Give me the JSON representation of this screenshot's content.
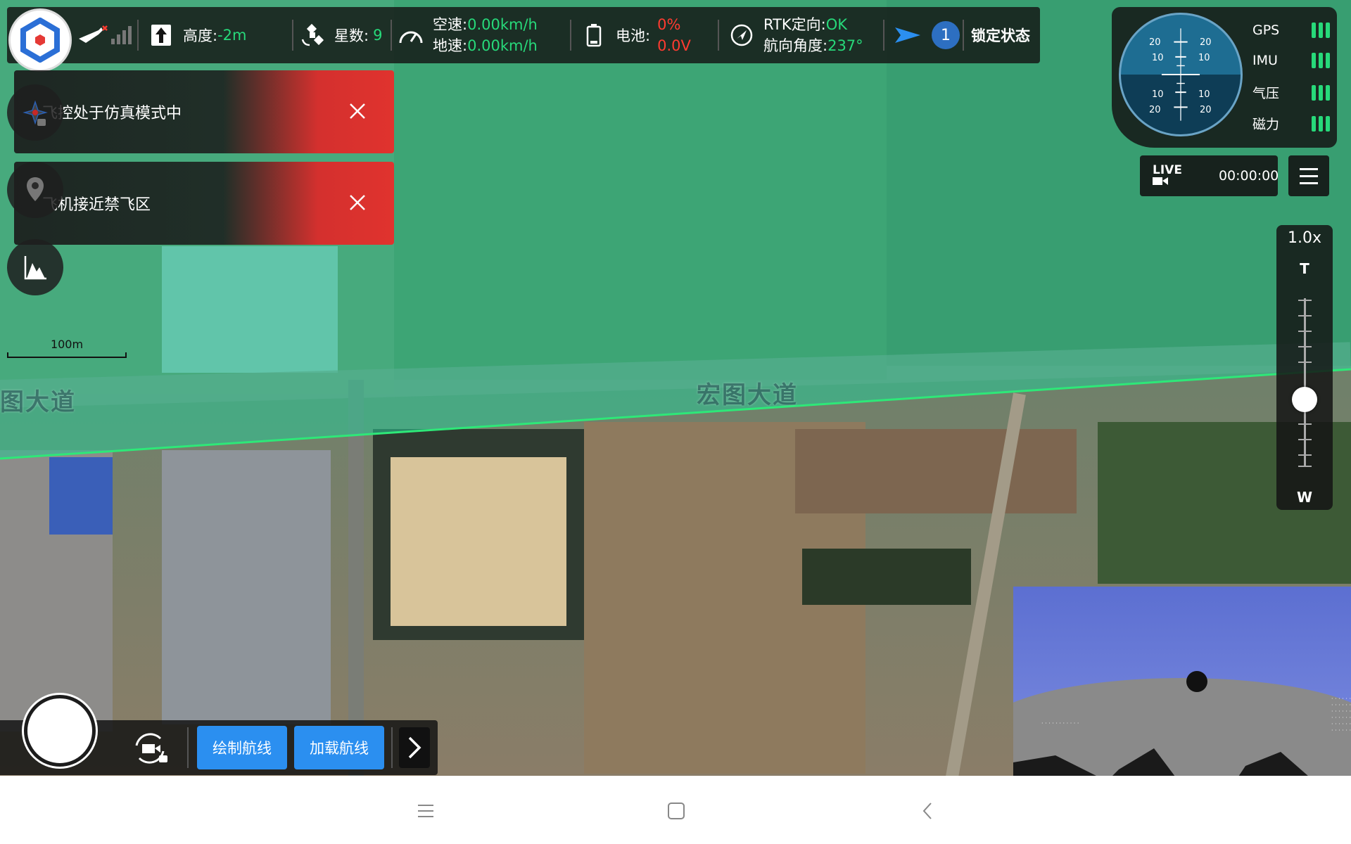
{
  "map": {
    "road_name_main": "宏图大道",
    "road_name_left": "图大道",
    "scale_label": "100m",
    "nofly_color": "#28c896"
  },
  "topbar": {
    "altitude_label": "高度:",
    "altitude_value": "-2m",
    "satellites_label": "星数:",
    "satellites_value": "9",
    "airspeed_label": "空速:",
    "airspeed_value": "0.00km/h",
    "groundspeed_label": "地速:",
    "groundspeed_value": "0.00km/h",
    "battery_label": "电池:",
    "battery_percent": "0%",
    "battery_voltage": "0.0V",
    "rtk_label": "RTK定向:",
    "rtk_value": "OK",
    "heading_label": "航向角度:",
    "heading_value": "237°",
    "aircraft_count": "1",
    "lock_state": "锁定状态"
  },
  "attitude": {
    "pitch_marks": [
      "20",
      "10",
      "10",
      "20"
    ],
    "sensors": [
      {
        "label": "GPS",
        "bars": 3
      },
      {
        "label": "IMU",
        "bars": 3
      },
      {
        "label": "气压",
        "bars": 3
      },
      {
        "label": "磁力",
        "bars": 3
      }
    ]
  },
  "live": {
    "label": "LIVE",
    "record_time": "00:00:00"
  },
  "zoom": {
    "value": "1.0x",
    "tele": "T",
    "wide": "W",
    "level": 0.4
  },
  "alerts": [
    {
      "text": "飞控处于仿真模式中",
      "icon": "drone-lock-icon"
    },
    {
      "text": "飞机接近禁飞区",
      "icon": "location-pin-icon"
    }
  ],
  "bottom": {
    "draw_route": "绘制航线",
    "load_route": "加载航线"
  },
  "colors": {
    "accent_blue": "#2b8ff0",
    "status_green": "#27d97a",
    "alert_red": "#e0332e"
  }
}
